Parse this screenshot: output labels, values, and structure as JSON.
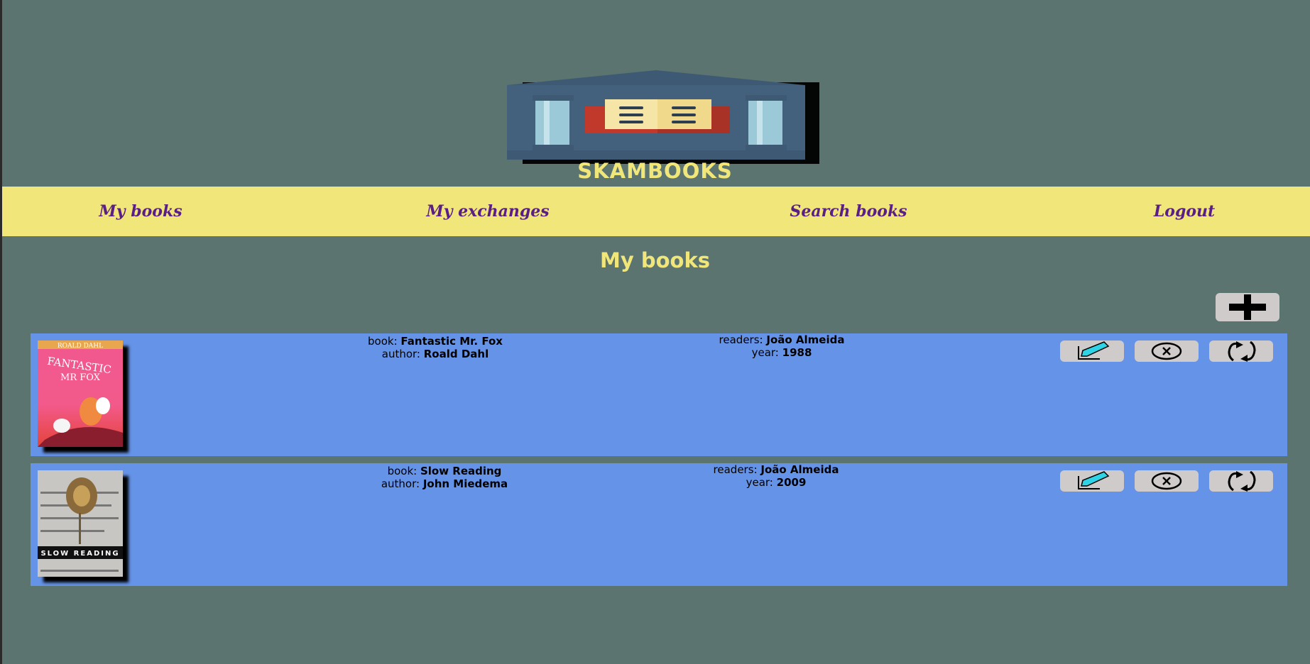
{
  "brand": {
    "name": "SKAMBOOKS"
  },
  "nav": {
    "items": [
      {
        "label": "My books"
      },
      {
        "label": "My exchanges"
      },
      {
        "label": "Search books"
      },
      {
        "label": "Logout"
      }
    ]
  },
  "page": {
    "title": "My books"
  },
  "labels": {
    "book": "book: ",
    "author": "author: ",
    "readers": "readers: ",
    "year": "year: "
  },
  "books": [
    {
      "title": "Fantastic Mr. Fox",
      "author": "Roald Dahl",
      "readers": "João Almeida",
      "year": "1988",
      "cover_text": {
        "top": "ROALD DAHL",
        "line1": "FANTASTIC",
        "line2": "MR FOX"
      }
    },
    {
      "title": "Slow Reading",
      "author": "John Miedema",
      "readers": "João Almeida",
      "year": "2009",
      "cover_text": {
        "band": "SLOW READING"
      }
    }
  ],
  "icons": {
    "add": "plus-icon",
    "edit": "pencil-icon",
    "delete": "circle-x-icon",
    "exchange": "refresh-arrows-icon"
  },
  "colors": {
    "background": "#5b7470",
    "nav": "#f1e67a",
    "nav_text": "#5a1f86",
    "title": "#f0e67a",
    "row": "#6593e8",
    "button": "#d0cbcb"
  }
}
